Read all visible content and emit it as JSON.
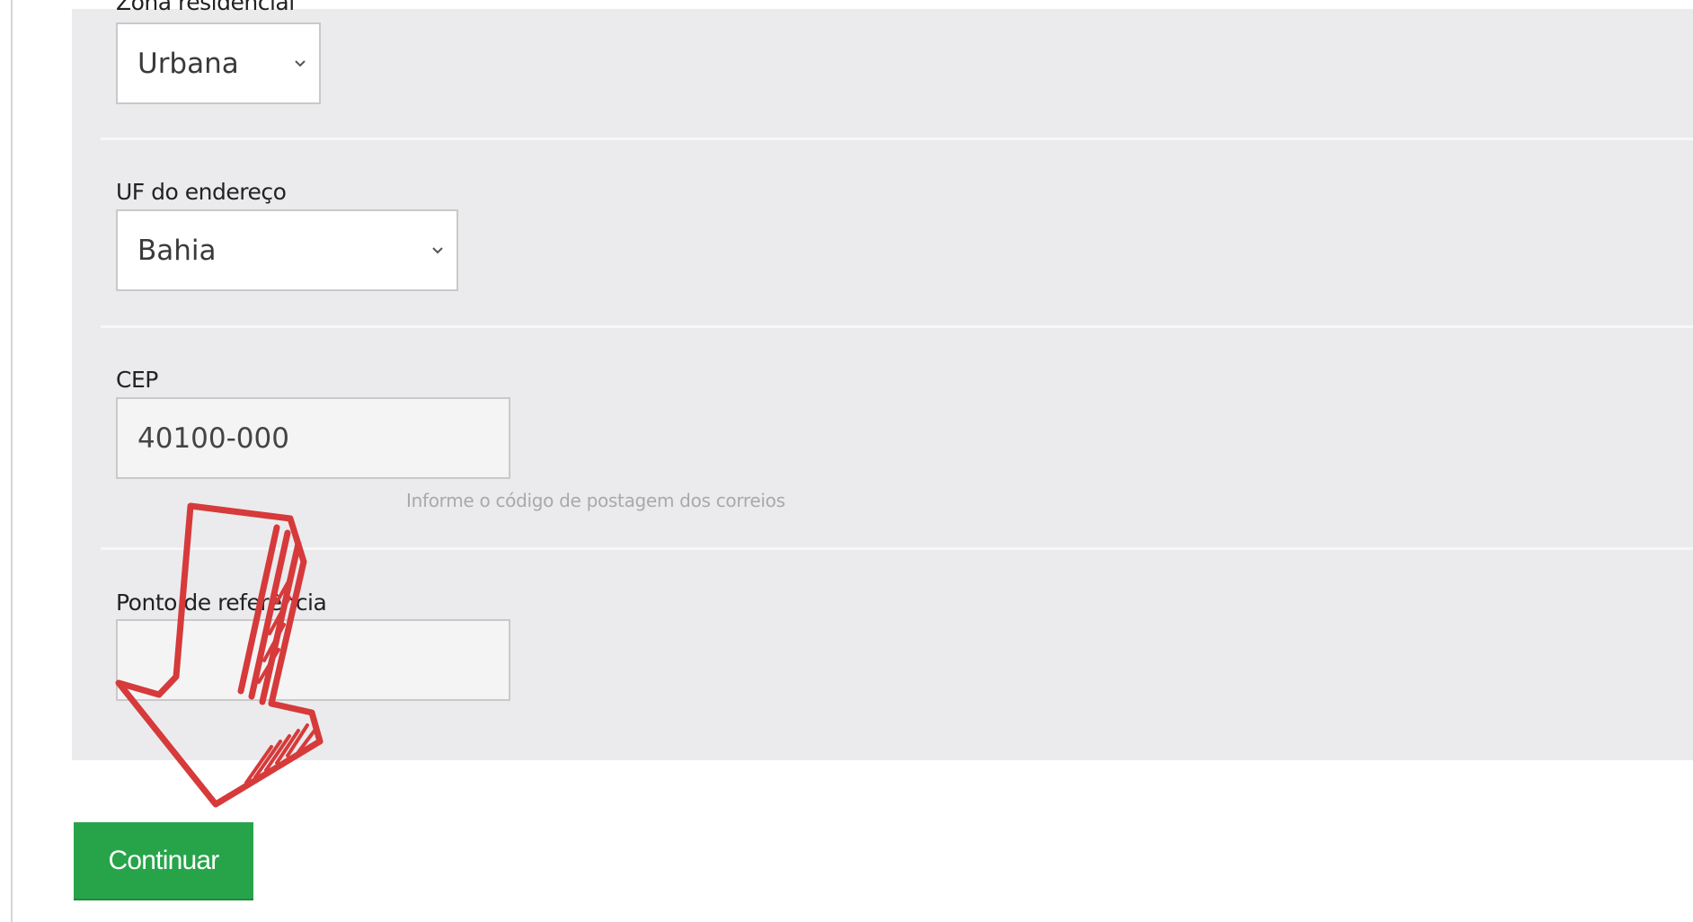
{
  "form": {
    "zona_residencial": {
      "label": "Zona residencial",
      "selected": "Urbana"
    },
    "uf_endereco": {
      "label": "UF do endereço",
      "selected": "Bahia"
    },
    "cep": {
      "label": "CEP",
      "value": "40100-000",
      "help": "Informe o código de postagem dos correios"
    },
    "ponto_referencia": {
      "label": "Ponto de referência",
      "value": ""
    }
  },
  "actions": {
    "continue_label": "Continuar"
  },
  "colors": {
    "panel": "#ebebed",
    "primary_button": "#27a449",
    "annotation_arrow": "#d63a3a"
  },
  "icons": {
    "select_chevron": "chevron-down-icon",
    "annotation": "hand-drawn-arrow-down-icon"
  }
}
